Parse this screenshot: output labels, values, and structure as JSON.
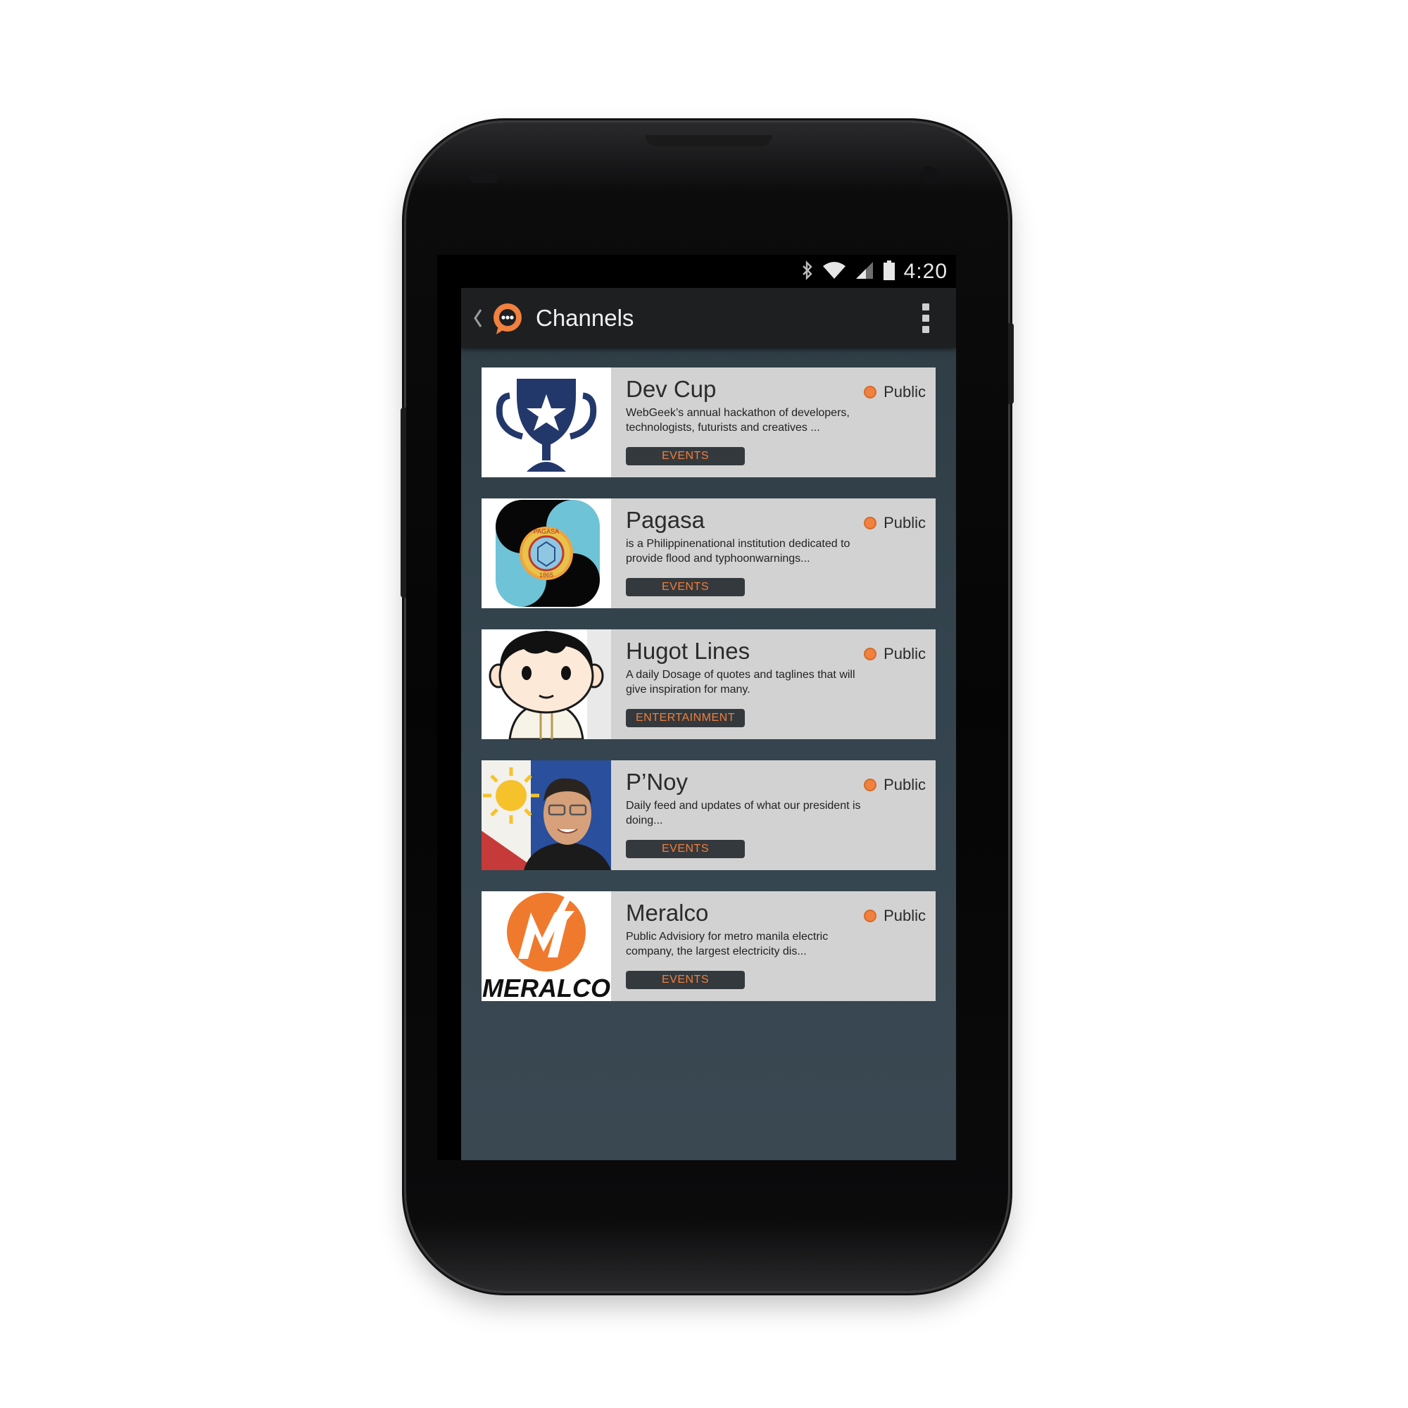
{
  "status_bar": {
    "time": "4:20",
    "icons": [
      "bluetooth-icon",
      "wifi-icon",
      "signal-icon",
      "battery-icon"
    ]
  },
  "action_bar": {
    "title": "Channels",
    "icons": [
      "back-chevron-icon",
      "chat-bubble-logo",
      "overflow-menu-icon"
    ]
  },
  "colors": {
    "accent": "#f0813f",
    "card_bg": "#d2d2d2",
    "tag_bg": "#34393d",
    "action_bar_bg": "#1e1f20",
    "screen_bg": "#34444e"
  },
  "channels": [
    {
      "name": "Dev Cup",
      "visibility": "Public",
      "description": "WebGeek’s annual hackathon of developers, technologists, futurists and creatives ...",
      "tag": "EVENTS",
      "thumbnail": "trophy-star-icon"
    },
    {
      "name": "Pagasa",
      "visibility": "Public",
      "description": "is a Philippinenational institution dedicated to provide flood and typhoonwarnings...",
      "tag": "EVENTS",
      "thumbnail": "pagasa-logo",
      "logo_text": [
        "PAGASA",
        "1865"
      ]
    },
    {
      "name": "Hugot Lines",
      "visibility": "Public",
      "description": "A daily Dosage of quotes and taglines that will give inspiration for many.",
      "tag": "ENTERTAINMENT",
      "thumbnail": "cartoon-boy-avatar"
    },
    {
      "name": "P’Noy",
      "visibility": "Public",
      "description": "Daily feed and updates of what our president is doing...",
      "tag": "EVENTS",
      "thumbnail": "president-portrait-flag"
    },
    {
      "name": "Meralco",
      "visibility": "Public",
      "description": "Public Advisiory for metro manila electric company, the largest electricity dis...",
      "tag": "EVENTS",
      "thumbnail": "meralco-logo",
      "logo_text": "MERALCO"
    }
  ]
}
